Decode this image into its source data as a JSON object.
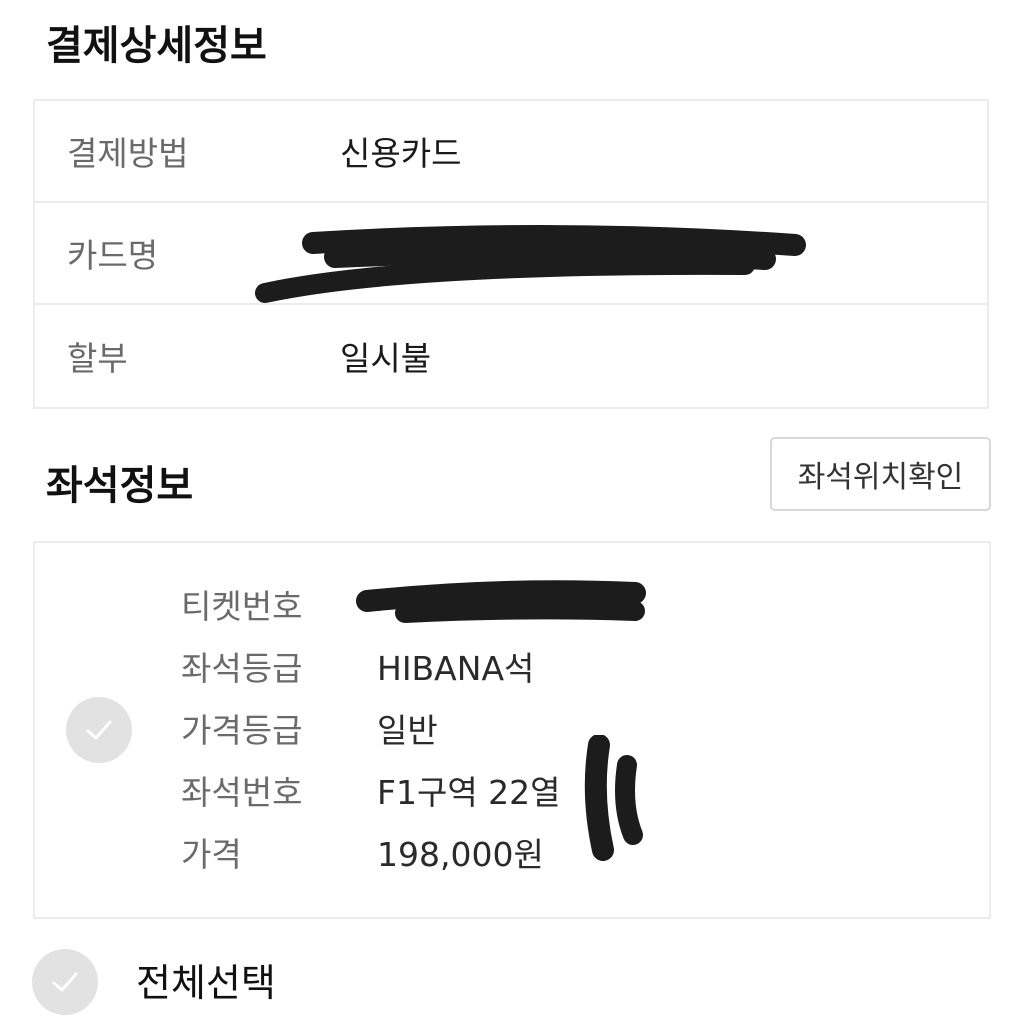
{
  "payment": {
    "title": "결제상세정보",
    "rows": [
      {
        "label": "결제방법",
        "value": "신용카드"
      },
      {
        "label": "카드명",
        "value": ""
      },
      {
        "label": "할부",
        "value": "일시불"
      }
    ]
  },
  "seat": {
    "title": "좌석정보",
    "location_button": "좌석위치확인",
    "rows": [
      {
        "label": "티켓번호",
        "value": ""
      },
      {
        "label": "좌석등급",
        "value": "HIBANA석"
      },
      {
        "label": "가격등급",
        "value": "일반"
      },
      {
        "label": "좌석번호",
        "value": "F1구역 22열"
      },
      {
        "label": "가격",
        "value": "198,000원"
      }
    ]
  },
  "select_all": {
    "label": "전체선택"
  },
  "icons": {
    "seat_check": "check-icon",
    "select_all_check": "check-icon"
  },
  "colors": {
    "check_bg": "#e2e2e2",
    "border": "#ececec",
    "label": "#6a6a6a"
  }
}
